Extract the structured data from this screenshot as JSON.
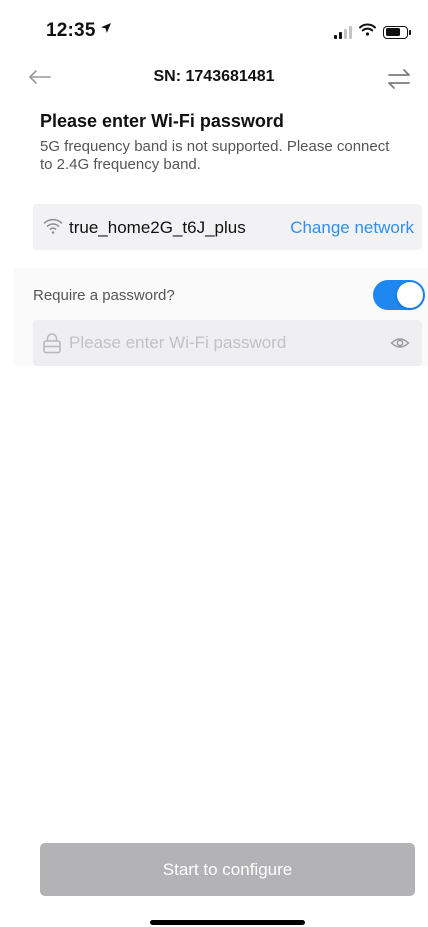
{
  "status_bar": {
    "time": "12:35",
    "location_glyph": "➤",
    "signal_bars_active": 2,
    "signal_bars_total": 4,
    "battery_level_fraction": 0.7
  },
  "nav": {
    "title": "SN: 1743681481",
    "back_icon": "arrow-left-icon",
    "switch_icon": "swap-arrows-icon"
  },
  "header": {
    "title": "Please enter Wi-Fi password",
    "subtitle": "5G frequency band is not supported. Please connect to 2.4G frequency band."
  },
  "network": {
    "icon": "wifi-icon",
    "ssid": "true_home2G_t6J_plus",
    "change_label": "Change network"
  },
  "password": {
    "require_label": "Require a password?",
    "require_enabled": true,
    "placeholder": "Please enter Wi-Fi password",
    "value": "",
    "lock_icon": "lock-icon",
    "visibility_icon": "eye-icon"
  },
  "footer": {
    "configure_label": "Start to configure"
  },
  "colors": {
    "accent": "#2f8ff0",
    "toggle_on": "#1e88f0",
    "button_disabled": "#b3b3b5",
    "card_bg": "#f2f2f4"
  }
}
